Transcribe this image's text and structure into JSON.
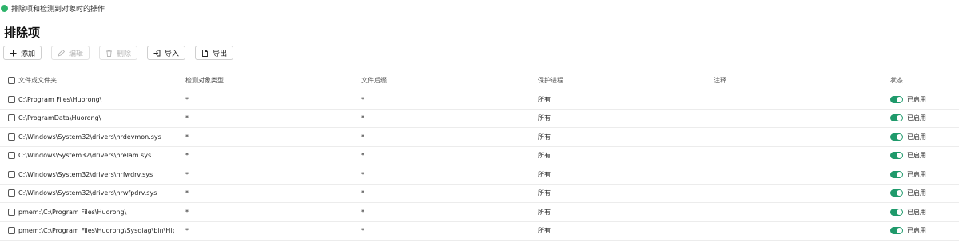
{
  "notice": {
    "text": "排除项和检测到对象时的操作",
    "color": "#2db36a"
  },
  "page": {
    "title": "排除项"
  },
  "toolbar": {
    "add_label": "添加",
    "edit_label": "编辑",
    "delete_label": "删除",
    "import_label": "导入",
    "export_label": "导出"
  },
  "table": {
    "headers": {
      "path": "文件或文件夹",
      "object_type": "检测对象类型",
      "extension": "文件后缀",
      "process": "保护进程",
      "note": "注释",
      "status": "状态"
    },
    "rows": [
      {
        "path": "C:\\Program Files\\Huorong\\",
        "object_type": "*",
        "extension": "*",
        "process": "所有",
        "note": "",
        "status": "已启用"
      },
      {
        "path": "C:\\ProgramData\\Huorong\\",
        "object_type": "*",
        "extension": "*",
        "process": "所有",
        "note": "",
        "status": "已启用"
      },
      {
        "path": "C:\\Windows\\System32\\drivers\\hrdevmon.sys",
        "object_type": "*",
        "extension": "*",
        "process": "所有",
        "note": "",
        "status": "已启用"
      },
      {
        "path": "C:\\Windows\\System32\\drivers\\hrelam.sys",
        "object_type": "*",
        "extension": "*",
        "process": "所有",
        "note": "",
        "status": "已启用"
      },
      {
        "path": "C:\\Windows\\System32\\drivers\\hrfwdrv.sys",
        "object_type": "*",
        "extension": "*",
        "process": "所有",
        "note": "",
        "status": "已启用"
      },
      {
        "path": "C:\\Windows\\System32\\drivers\\hrwfpdrv.sys",
        "object_type": "*",
        "extension": "*",
        "process": "所有",
        "note": "",
        "status": "已启用"
      },
      {
        "path": "pmem:\\C:\\Program Files\\Huorong\\",
        "object_type": "*",
        "extension": "*",
        "process": "所有",
        "note": "",
        "status": "已启用"
      },
      {
        "path": "pmem:\\C:\\Program Files\\Huorong\\Sysdiag\\bin\\HipsD...",
        "object_type": "*",
        "extension": "*",
        "process": "所有",
        "note": "",
        "status": "已启用"
      }
    ],
    "toggle_color": "#1f9a6b"
  }
}
